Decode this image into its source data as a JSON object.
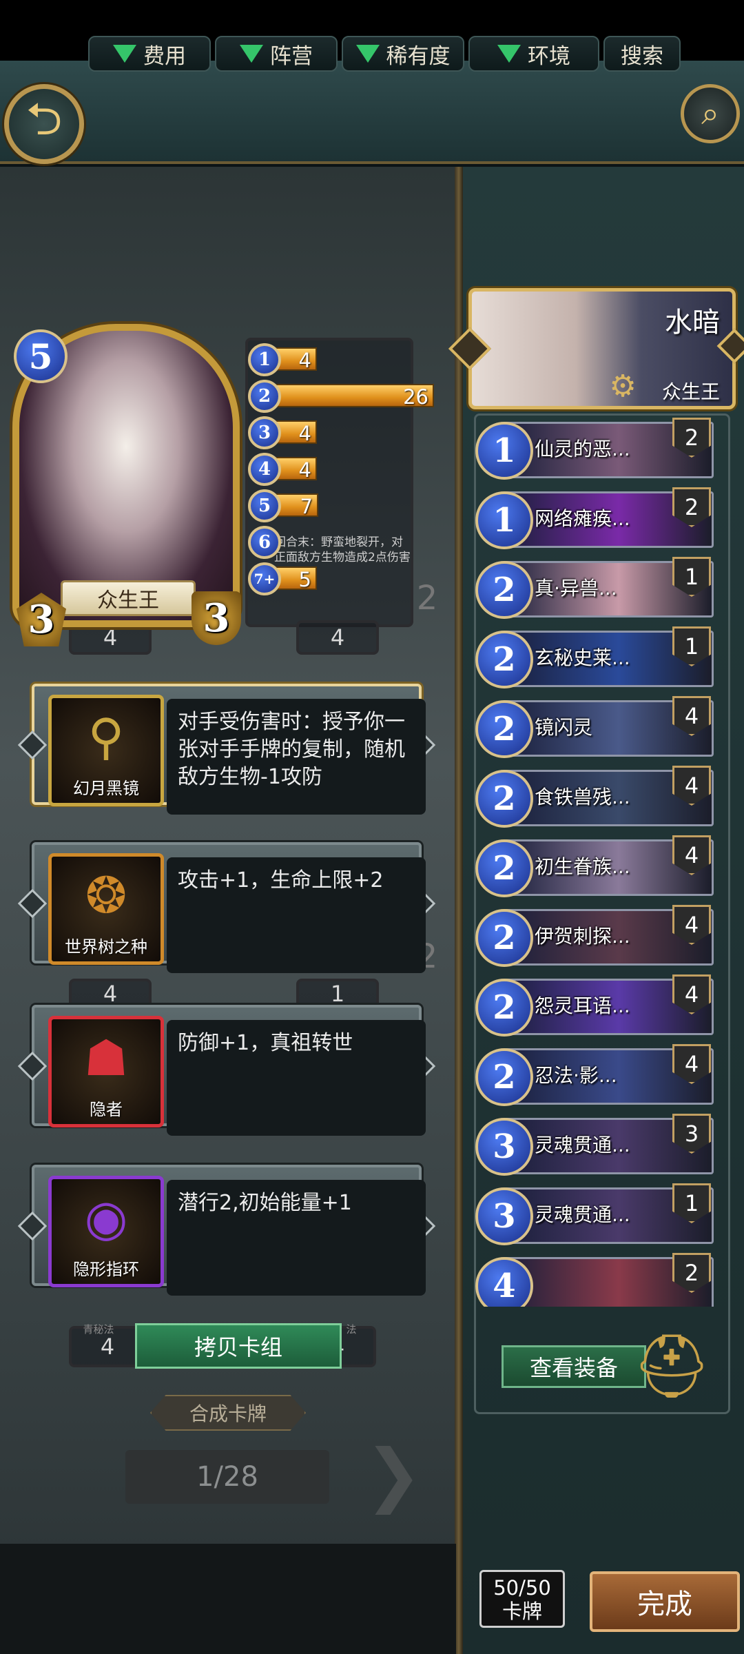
{
  "filters": {
    "cost": "费用",
    "faction": "阵营",
    "rarity": "稀有度",
    "environment": "环境",
    "search": "搜索"
  },
  "hero": {
    "name": "众生王",
    "cost": "5",
    "attack": "3",
    "health": "3"
  },
  "cost_curve": [
    {
      "cost": "1",
      "count": 4
    },
    {
      "cost": "2",
      "count": 26
    },
    {
      "cost": "3",
      "count": 4
    },
    {
      "cost": "4",
      "count": 4
    },
    {
      "cost": "5",
      "count": 7
    },
    {
      "cost": "6",
      "count": 0
    },
    {
      "cost": "7+",
      "count": 5
    }
  ],
  "background_card": {
    "description": "回合末：野蛮地裂开，对正面敌方生物造成2点伤害",
    "cost_left": "4",
    "cost_right": "4",
    "mid_left": "4",
    "mid_right": "1",
    "side_num_a": "2",
    "side_num_b": "2",
    "bottom_left": "4",
    "bottom_right": "4",
    "tag_left": "青秘法",
    "tag_right": "法"
  },
  "equipment": [
    {
      "name": "幻月黑镜",
      "description": "对手受伤害时：授予你一张对手手牌的复制，随机敌方生物-1攻防",
      "frame_color": "#c8a640",
      "icon": "mirror-icon"
    },
    {
      "name": "世界树之种",
      "description": "攻击+1，生命上限+2",
      "frame_color": "#d08a2a",
      "icon": "prayer-beads-icon"
    },
    {
      "name": "隐者",
      "description": "防御+1，真祖转世",
      "frame_color": "#d8313a",
      "icon": "hooded-mask-icon"
    },
    {
      "name": "隐形指环",
      "description": "潜行2,初始能量+1",
      "frame_color": "#8a3ad0",
      "icon": "ring-icon"
    }
  ],
  "actions": {
    "copy_deck": "拷贝卡组",
    "craft_card": "合成卡牌",
    "page": "1/28",
    "view_equipment": "查看装备",
    "done": "完成"
  },
  "commander": {
    "title": "水暗",
    "subtitle": "众生王"
  },
  "deck_list": [
    {
      "cost": "1",
      "name": "仙灵的恶...",
      "count": "2",
      "art": "#7a5a78"
    },
    {
      "cost": "1",
      "name": "网络瘫痪...",
      "count": "2",
      "art": "#7a2aa8"
    },
    {
      "cost": "2",
      "name": "真·异兽...",
      "count": "1",
      "art": "#c89aa8"
    },
    {
      "cost": "2",
      "name": "玄秘史莱...",
      "count": "1",
      "art": "#2a4a9a"
    },
    {
      "cost": "2",
      "name": "镜闪灵",
      "count": "4",
      "art": "#4a5a8a"
    },
    {
      "cost": "2",
      "name": "食铁兽残...",
      "count": "4",
      "art": "#3a4a6a"
    },
    {
      "cost": "2",
      "name": "初生眷族...",
      "count": "4",
      "art": "#8a7a9a"
    },
    {
      "cost": "2",
      "name": "伊贺刺探...",
      "count": "4",
      "art": "#5a3a4a"
    },
    {
      "cost": "2",
      "name": "怨灵耳语...",
      "count": "4",
      "art": "#5a3aa8"
    },
    {
      "cost": "2",
      "name": "忍法·影...",
      "count": "4",
      "art": "#3a4a8a"
    },
    {
      "cost": "3",
      "name": "灵魂贯通...",
      "count": "3",
      "art": "#4a3a6a"
    },
    {
      "cost": "3",
      "name": "灵魂贯通...",
      "count": "1",
      "art": "#4a3a6a"
    },
    {
      "cost": "4",
      "name": "",
      "count": "2",
      "art": "#8a3a4a"
    }
  ],
  "deck_size": {
    "value": "50/50",
    "label": "卡牌"
  }
}
